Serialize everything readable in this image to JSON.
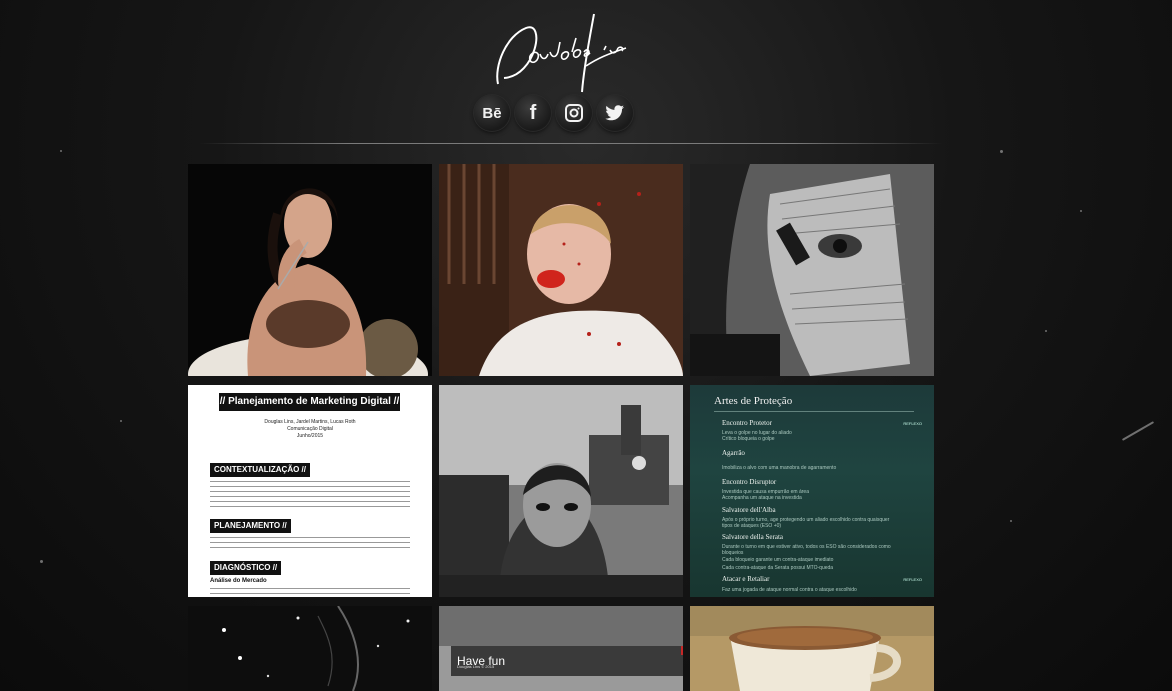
{
  "header": {
    "logo_text": "Douglas Lins",
    "social": [
      {
        "name": "behance",
        "label": "Bē"
      },
      {
        "name": "facebook",
        "label": "f"
      },
      {
        "name": "instagram",
        "label": ""
      },
      {
        "name": "twitter",
        "label": ""
      }
    ]
  },
  "gallery": {
    "tile_doc": {
      "title": "// Planejamento de Marketing Digital //",
      "meta": [
        "Douglas Lins, Jardel Martins, Lucas Roth",
        "Comunicação Digital",
        "Junho/2015"
      ],
      "sections": [
        {
          "heading": "CONTEXTUALIZAÇÃO //"
        },
        {
          "heading": "PLANEJAMENTO //"
        },
        {
          "heading": "DIAGNÓSTICO //"
        }
      ],
      "subheading": "Análise do Mercado"
    },
    "tile_cards": {
      "title": "Artes de Proteção",
      "entries": [
        {
          "name": "Encontro Protetor",
          "desc": [
            "Leva o golpe no lugar do aliado",
            "Crítico bloqueia o golpe"
          ],
          "tag": "REFLEXO"
        },
        {
          "name": "Agarrão",
          "desc": [
            "Imobiliza o alvo com uma manobra de agarramento"
          ],
          "tag": ""
        },
        {
          "name": "Encontro Disruptor",
          "desc": [
            "Investida que causa empurrão em área",
            "Acompanha um ataque na investida"
          ],
          "tag": ""
        },
        {
          "name": "Salvatore dell'Alba",
          "desc": [
            "Após o próprio turno, age protegendo um aliado escolhido contra quaisquer",
            "tipos de ataques (ESO +0)"
          ],
          "tag": ""
        },
        {
          "name": "Salvatore della Serata",
          "desc": [
            "Durante o turno em que estiver ativo, todos os ESO são considerados como",
            "bloqueios",
            "Cada bloqueio garante um contra-ataque imediato",
            "Cada contra-ataque da Serata possui MTO-queda"
          ],
          "tag": ""
        },
        {
          "name": "Atacar e Retaliar",
          "desc": [
            "Faz uma jogada de ataque normal contra o ataque escolhido"
          ],
          "tag": "REFLEXO"
        }
      ]
    },
    "tile_popup": {
      "text": "Have fun",
      "close": "X",
      "sub": "Douglas Lins © 2015"
    }
  }
}
